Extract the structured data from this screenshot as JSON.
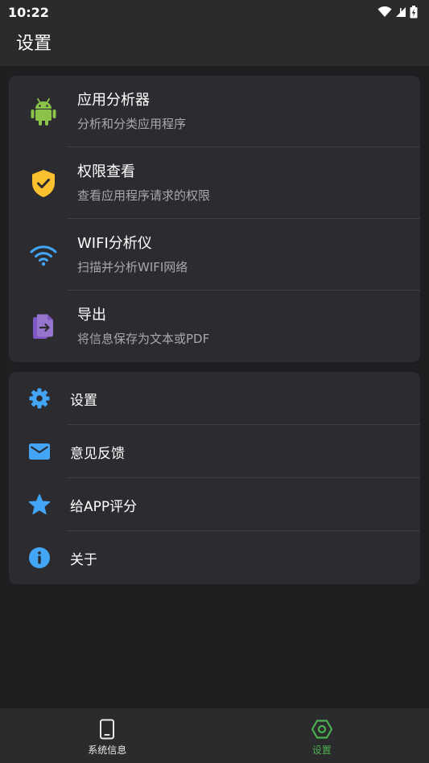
{
  "status_bar": {
    "time": "10:22"
  },
  "app_bar": {
    "title": "设置"
  },
  "tools": [
    {
      "title": "应用分析器",
      "subtitle": "分析和分类应用程序",
      "icon": "android-icon"
    },
    {
      "title": "权限查看",
      "subtitle": "查看应用程序请求的权限",
      "icon": "shield-check-icon"
    },
    {
      "title": "WIFI分析仪",
      "subtitle": "扫描并分析WIFI网络",
      "icon": "wifi-icon"
    },
    {
      "title": "导出",
      "subtitle": "将信息保存为文本或PDF",
      "icon": "export-icon"
    }
  ],
  "settings": [
    {
      "label": "设置",
      "icon": "gear-icon"
    },
    {
      "label": "意见反馈",
      "icon": "mail-icon"
    },
    {
      "label": "给APP评分",
      "icon": "star-icon"
    },
    {
      "label": "关于",
      "icon": "info-icon"
    }
  ],
  "bottom_nav": [
    {
      "label": "系统信息",
      "icon": "phone-icon",
      "active": false
    },
    {
      "label": "设置",
      "icon": "hexagon-icon",
      "active": true
    }
  ],
  "colors": {
    "android_green": "#8bc34a",
    "shield_yellow": "#fbc02d",
    "accent_blue": "#42a5f5",
    "export_purple": "#9575cd",
    "active_green": "#4caf50"
  }
}
